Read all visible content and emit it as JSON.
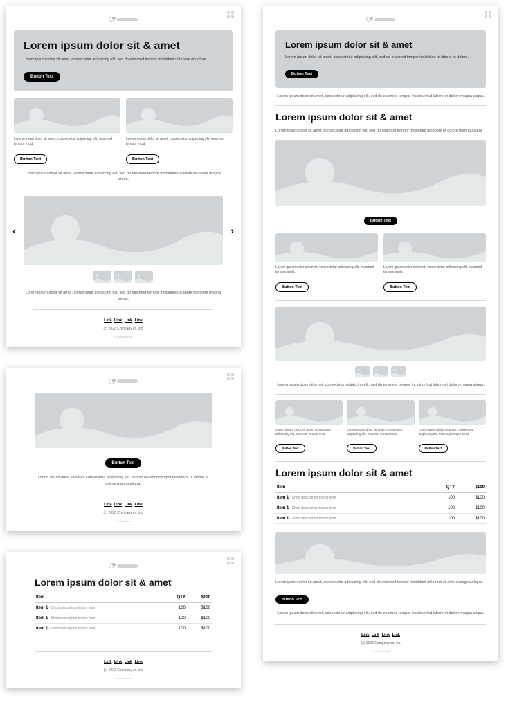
{
  "hero": {
    "title": "Lorem ipsum dolor sit & amet",
    "body": "Lorem ipsum dolor sit amet, consectetur adipiscing elit, sed do eiusmod tempor incididunt ut labore et dolore.",
    "button": "Button Text"
  },
  "card": {
    "body": "Lorem ipsum dolor sit amet, consectetur adipiscing elit, eiusmod tempor incid.",
    "button": "Button Text"
  },
  "paragraph": "Lorem ipsum dolor sit amet, consectetur adipiscing elit, sed do eiusmod tempor incididunt ut labore et dolore magna aliqua.",
  "section_title": "Lorem ipsum dolor sit & amet",
  "table": {
    "headers": {
      "item": "Item",
      "qty": "QTY",
      "price": "$100"
    },
    "rows": [
      {
        "item": "Item 1",
        "desc": " - Short description text or item",
        "qty": "100",
        "price": "$100"
      },
      {
        "item": "Item 1",
        "desc": " - Short description text or item",
        "qty": "100",
        "price": "$100"
      },
      {
        "item": "Item 1",
        "desc": " - Short description text or item",
        "qty": "100",
        "price": "$100"
      }
    ]
  },
  "footer": {
    "links": [
      "Link",
      "Link",
      "Link",
      "Link"
    ],
    "copyright": "(c) 2023 Company co. inc",
    "mark": "unsubscribe"
  },
  "buttons": {
    "main": "Button Text"
  }
}
